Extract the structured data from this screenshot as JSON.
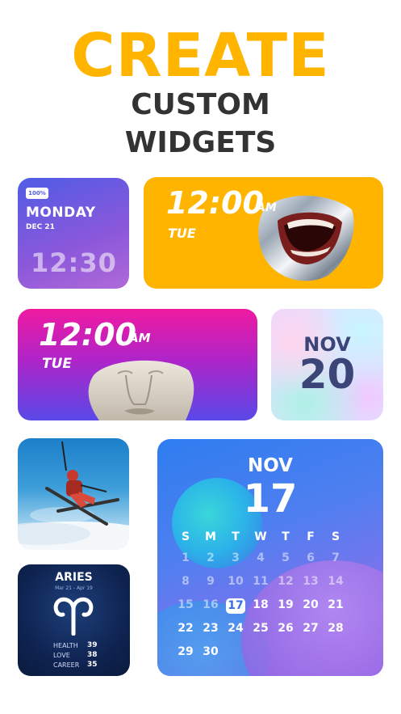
{
  "header": {
    "line1": "CREATE",
    "line2": "CUSTOM",
    "line3": "WIDGETS",
    "accent_color": "#ffb400",
    "text_color": "#333333"
  },
  "widget_small_clock": {
    "battery": "100%",
    "day": "MONDAY",
    "date": "DEC 21",
    "time": "12:30"
  },
  "widget_orange_clock": {
    "time": "12:00",
    "ampm": "AM",
    "day": "TUE",
    "background": "#ffb400"
  },
  "widget_magenta_clock": {
    "time": "12:00",
    "ampm": "AM",
    "day": "TUE"
  },
  "widget_holo_date": {
    "month": "NOV",
    "day": "20"
  },
  "widget_photo": {
    "icon": "skier-photo"
  },
  "widget_aries": {
    "sign": "ARIES",
    "range": "Mar 21 - Apr 19",
    "symbol_icon": "aries-icon",
    "stats": [
      {
        "label": "HEALTH",
        "value": "39"
      },
      {
        "label": "LOVE",
        "value": "38"
      },
      {
        "label": "CAREER",
        "value": "35"
      }
    ]
  },
  "widget_calendar": {
    "month": "NOV",
    "day": "17",
    "weekdays": [
      "S",
      "M",
      "T",
      "W",
      "T",
      "F",
      "S"
    ],
    "weeks": [
      [
        "1",
        "2",
        "3",
        "4",
        "5",
        "6",
        "7"
      ],
      [
        "8",
        "9",
        "10",
        "11",
        "12",
        "13",
        "14"
      ],
      [
        "15",
        "16",
        "17",
        "18",
        "19",
        "20",
        "21"
      ],
      [
        "22",
        "23",
        "24",
        "25",
        "26",
        "27",
        "28"
      ],
      [
        "29",
        "30"
      ]
    ],
    "today": "17"
  }
}
